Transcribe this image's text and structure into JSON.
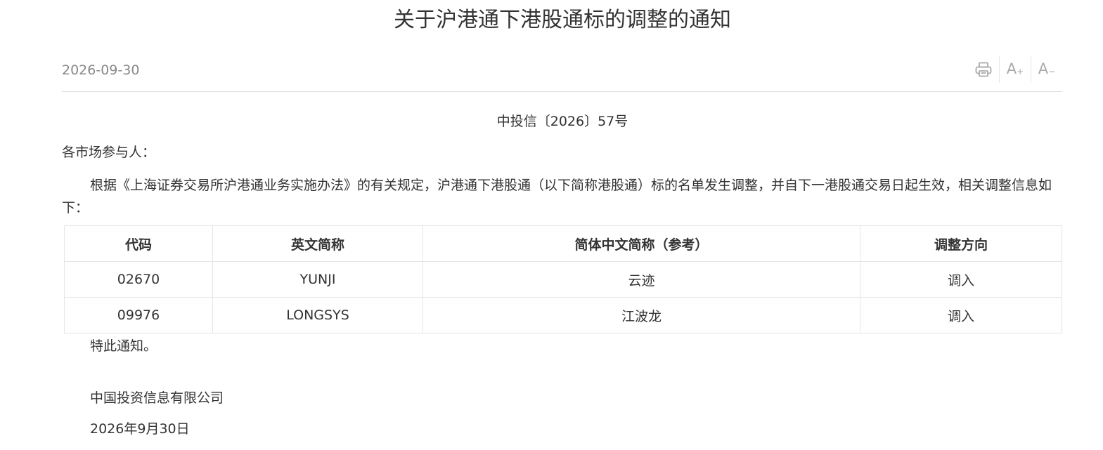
{
  "title": "关于沪港通下港股通标的调整的通知",
  "meta": {
    "date": "2026-09-30",
    "tools": {
      "print_icon": "printer-icon",
      "font_increase": "A",
      "font_increase_sign": "+",
      "font_decrease": "A",
      "font_decrease_sign": "−"
    }
  },
  "doc_number": "中投信〔2026〕57号",
  "salutation": "各市场参与人：",
  "body": "根据《上海证券交易所沪港通业务实施办法》的有关规定，沪港通下港股通（以下简称港股通）标的名单发生调整，并自下一港股通交易日起生效，相关调整信息如下：",
  "table": {
    "headers": [
      "代码",
      "英文简称",
      "简体中文简称（参考）",
      "调整方向"
    ],
    "rows": [
      [
        "02670",
        "YUNJI",
        "云迹",
        "调入"
      ],
      [
        "09976",
        "LONGSYS",
        "江波龙",
        "调入"
      ]
    ]
  },
  "closing": "特此通知。",
  "signature": {
    "company": "中国投资信息有限公司",
    "date": "2026年9月30日"
  }
}
